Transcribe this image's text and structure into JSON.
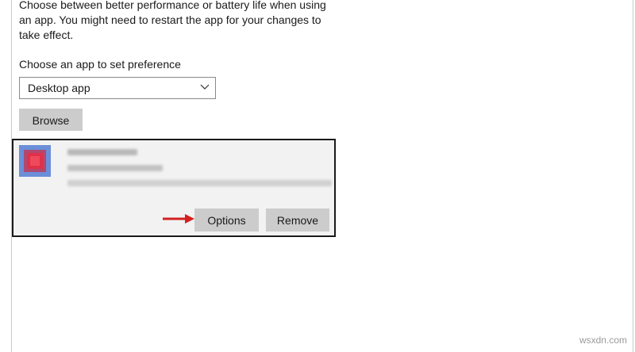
{
  "description": "Choose between better performance or battery life when using an app. You might need to restart the app for your changes to take effect.",
  "preference_label": "Choose an app to set preference",
  "dropdown": {
    "selected": "Desktop app",
    "icon": "chevron-down-icon"
  },
  "browse_label": "Browse",
  "app_card": {
    "icon": "app-icon",
    "options_label": "Options",
    "remove_label": "Remove",
    "arrow_icon": "red-arrow-icon"
  },
  "watermark": "wsxdn.com",
  "colors": {
    "button_bg": "#cccccc",
    "card_bg": "#f2f2f2",
    "card_border": "#1a1a1a",
    "arrow": "#d42020",
    "app_icon": "#e0304a"
  }
}
